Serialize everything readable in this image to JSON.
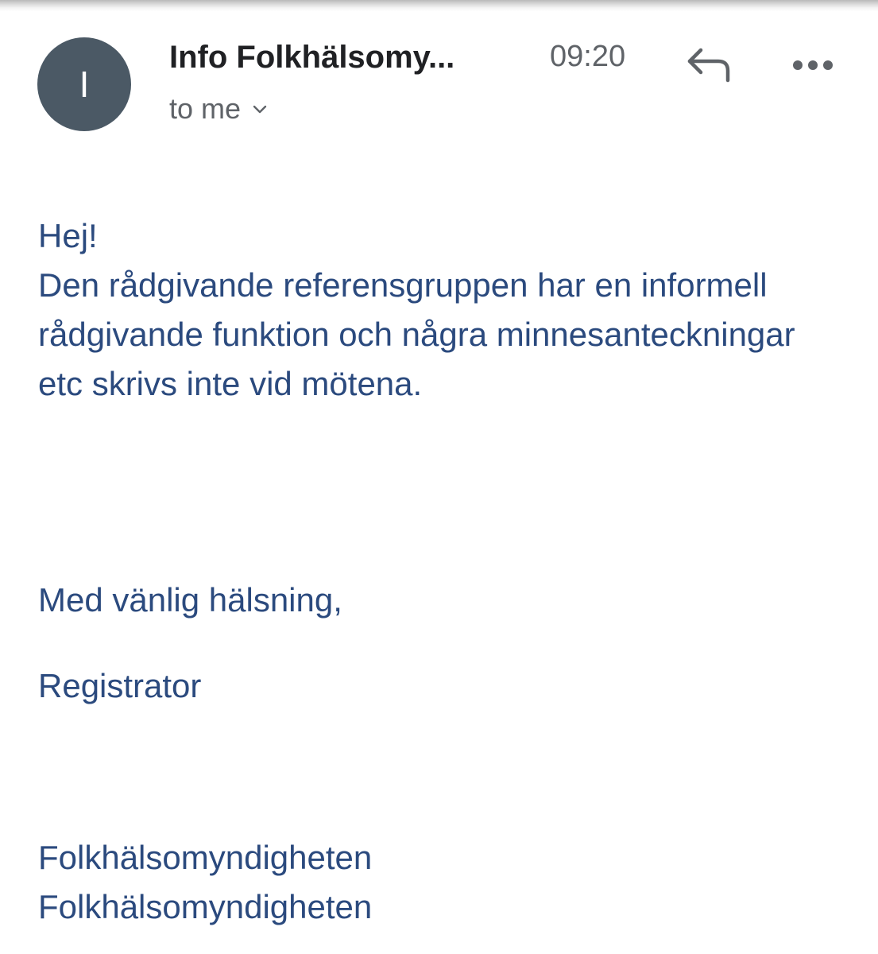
{
  "email": {
    "avatar_initial": "I",
    "sender": "Info Folkhälsomy...",
    "time": "09:20",
    "recipient": "to me",
    "reply_icon": "reply-icon",
    "more_icon": "more-horizontal-icon",
    "chevron_icon": "chevron-down-icon"
  },
  "message": {
    "greeting": "Hej!",
    "paragraph": "Den rådgivande referensgruppen har en informell rådgivande funktion och några minnesanteckningar etc skrivs inte vid mötena.",
    "closing": "Med vänlig hälsning,",
    "role": "Registrator",
    "signature_lines": [
      "Folkhälsomyndigheten",
      "Folkhälsomyndigheten"
    ]
  },
  "colors": {
    "avatar_bg": "#4b5965",
    "body_text": "#2b4a7e",
    "sender_text": "#202124",
    "meta_text": "#5f6368"
  }
}
